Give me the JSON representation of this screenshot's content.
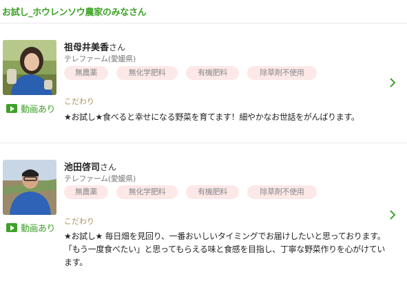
{
  "section": {
    "title": "お試し_ホウレンソウ農家のみなさん"
  },
  "farmers": [
    {
      "name": "祖母井美香",
      "suffix": "さん",
      "farm": "テレファーム(愛媛県)",
      "tags": [
        "無農薬",
        "無化学肥料",
        "有機肥料",
        "除草剤不使用"
      ],
      "kodawari_label": "こだわり",
      "description": "★お試し★食べると幸せになる野菜を育てます！細やかなお世話をがんばります。",
      "video_label": "動画あり"
    },
    {
      "name": "池田啓司",
      "suffix": "さん",
      "farm": "テレファーム(愛媛県)",
      "tags": [
        "無農薬",
        "無化学肥料",
        "有機肥料",
        "除草剤不使用"
      ],
      "kodawari_label": "こだわり",
      "description": "★お試し★ 毎日畑を見回り、一番おいしいタイミングでお届けしたいと思っております。「もう一度食べたい」と思ってもらえる味と食感を目指し、丁寧な野菜作りを心がけています。",
      "video_label": "動画あり"
    }
  ],
  "colors": {
    "accent": "#3ba226",
    "tag_bg": "#fde8e8",
    "kodawari": "#a89060"
  },
  "icons": {
    "video": "play-icon",
    "more": "chevron-right-icon"
  }
}
